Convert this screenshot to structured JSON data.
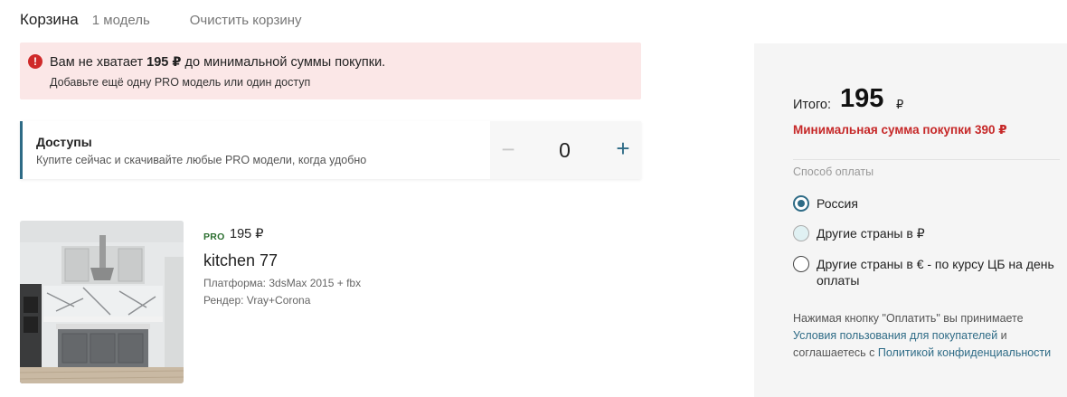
{
  "header": {
    "title": "Корзина",
    "count": "1 модель",
    "clear_label": "Очистить корзину"
  },
  "alert": {
    "icon": "!",
    "line1_prefix": "Вам не хватает ",
    "line1_amount": "195 ₽",
    "line1_suffix": " до минимальной суммы покупки.",
    "line2": "Добавьте ещё одну PRO модель или один доступ"
  },
  "access": {
    "title": "Доступы",
    "description": "Купите сейчас и скачивайте любые PRO модели, когда удобно",
    "minus": "−",
    "quantity": "0",
    "plus": "+"
  },
  "product": {
    "tag": "PRO",
    "price": "195 ₽",
    "name": "kitchen 77",
    "platform": "Платформа: 3dsMax 2015 + fbx",
    "render": "Рендер: Vray+Corona"
  },
  "summary": {
    "total_label": "Итого:",
    "total_value": "195",
    "total_currency": "₽",
    "min_sum": "Минимальная сумма покупки 390 ₽",
    "payment_label": "Способ оплаты",
    "options": [
      {
        "label": "Россия",
        "selected": true
      },
      {
        "label": "Другие страны в ₽",
        "selected": false
      },
      {
        "label": "Другие страны в € - по курсу ЦБ на день оплаты",
        "selected": false
      }
    ],
    "terms_prefix": "Нажимая кнопку \"Оплатить\" вы принимаете ",
    "terms_link1": "Условия пользования для покупателей",
    "terms_middle": " и соглашаетесь с ",
    "terms_link2": "Политикой конфиденциальности"
  },
  "colors": {
    "accent": "#2e6b86",
    "alert_bg": "#fbe7e7",
    "error": "#c62828",
    "pro_tag": "#2b6e2f"
  }
}
